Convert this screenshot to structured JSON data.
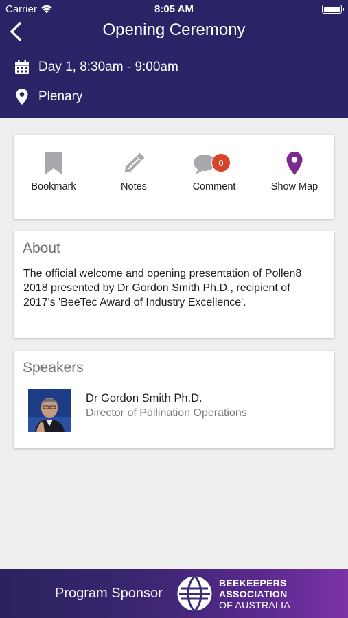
{
  "status_bar": {
    "carrier": "Carrier",
    "time": "8:05 AM"
  },
  "header": {
    "title": "Opening Ceremony",
    "date": "Day 1, 8:30am - 9:00am",
    "location": "Plenary",
    "background_color": "#2a2466"
  },
  "actions": [
    {
      "label": "Bookmark",
      "icon": "bookmark-icon"
    },
    {
      "label": "Notes",
      "icon": "pencil-icon"
    },
    {
      "label": "Comment",
      "icon": "comment-icon",
      "badge": "0"
    },
    {
      "label": "Show Map",
      "icon": "map-pin-icon"
    }
  ],
  "about": {
    "heading": "About",
    "text": "The official welcome and opening presentation of Pollen8 2018 presented by Dr Gordon Smith Ph.D., recipient of 2017's 'BeeTec Award of Industry Excellence'."
  },
  "speakers": {
    "heading": "Speakers",
    "items": [
      {
        "name": "Dr Gordon Smith Ph.D.",
        "role": "Director of Pollination Operations"
      }
    ]
  },
  "sponsor": {
    "label": "Program Sponsor",
    "logo_line1": "BEEKEEPERS",
    "logo_line2": "ASSOCIATION",
    "logo_line3": "OF AUSTRALIA"
  },
  "colors": {
    "accent_purple": "#7b2a8c",
    "icon_gray": "#a9a9ad",
    "badge_red": "#d9432b"
  }
}
